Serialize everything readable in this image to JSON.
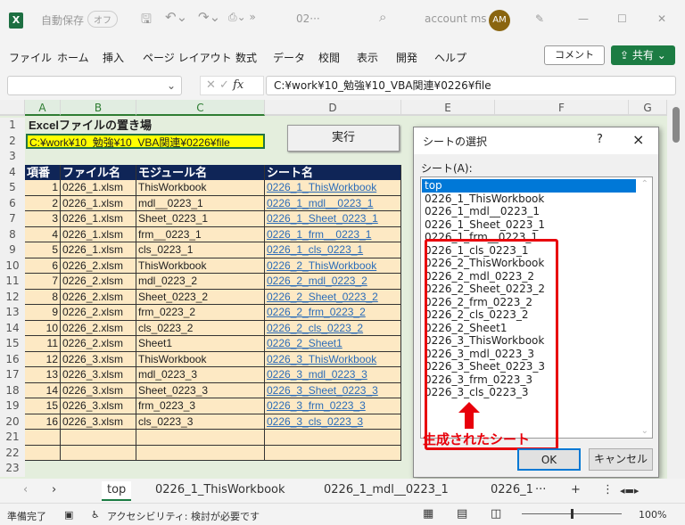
{
  "titlebar": {
    "app_icon": "excel-icon",
    "autosave_label": "自動保存",
    "autosave_state": "オフ",
    "filename": "02···",
    "account": "account ms",
    "avatar_initials": "AM"
  },
  "menu": {
    "items": [
      "ファイル",
      "ホーム",
      "挿入",
      "ページ レイアウト",
      "数式",
      "データ",
      "校閲",
      "表示",
      "開発",
      "ヘルプ"
    ],
    "comment": "コメント",
    "share": "共有"
  },
  "formula_bar": {
    "name_box": "",
    "fx": "fx",
    "value": "C:¥work¥10_勉強¥10_VBA関連¥0226¥file"
  },
  "grid": {
    "columns": [
      "A",
      "B",
      "C",
      "D",
      "E",
      "F",
      "G"
    ],
    "rows": [
      "1",
      "2",
      "3",
      "4",
      "5",
      "6",
      "7",
      "8",
      "9",
      "10",
      "11",
      "12",
      "13",
      "14",
      "15",
      "16",
      "17",
      "18",
      "19",
      "20",
      "21",
      "22",
      "23"
    ],
    "title": "Excelファイルの置き場",
    "path": "C:¥work¥10_勉強¥10_VBA関連¥0226¥file",
    "run_button": "実行",
    "headers": [
      "項番",
      "ファイル名",
      "モジュール名",
      "シート名"
    ],
    "data": [
      [
        "1",
        "0226_1.xlsm",
        "ThisWorkbook",
        "0226_1_ThisWorkbook"
      ],
      [
        "2",
        "0226_1.xlsm",
        "mdl__0223_1",
        "0226_1_mdl__0223_1"
      ],
      [
        "3",
        "0226_1.xlsm",
        "Sheet_0223_1",
        "0226_1_Sheet_0223_1"
      ],
      [
        "4",
        "0226_1.xlsm",
        "frm__0223_1",
        "0226_1_frm__0223_1"
      ],
      [
        "5",
        "0226_1.xlsm",
        "cls_0223_1",
        "0226_1_cls_0223_1"
      ],
      [
        "6",
        "0226_2.xlsm",
        "ThisWorkbook",
        "0226_2_ThisWorkbook"
      ],
      [
        "7",
        "0226_2.xlsm",
        "mdl_0223_2",
        "0226_2_mdl_0223_2"
      ],
      [
        "8",
        "0226_2.xlsm",
        "Sheet_0223_2",
        "0226_2_Sheet_0223_2"
      ],
      [
        "9",
        "0226_2.xlsm",
        "frm_0223_2",
        "0226_2_frm_0223_2"
      ],
      [
        "10",
        "0226_2.xlsm",
        "cls_0223_2",
        "0226_2_cls_0223_2"
      ],
      [
        "11",
        "0226_2.xlsm",
        "Sheet1",
        "0226_2_Sheet1"
      ],
      [
        "12",
        "0226_3.xlsm",
        "ThisWorkbook",
        "0226_3_ThisWorkbook"
      ],
      [
        "13",
        "0226_3.xlsm",
        "mdl_0223_3",
        "0226_3_mdl_0223_3"
      ],
      [
        "14",
        "0226_3.xlsm",
        "Sheet_0223_3",
        "0226_3_Sheet_0223_3"
      ],
      [
        "15",
        "0226_3.xlsm",
        "frm_0223_3",
        "0226_3_frm_0223_3"
      ],
      [
        "16",
        "0226_3.xlsm",
        "cls_0223_3",
        "0226_3_cls_0223_3"
      ],
      [
        "",
        "",
        "",
        ""
      ],
      [
        "",
        "",
        "",
        ""
      ]
    ]
  },
  "dialog": {
    "title": "シートの選択",
    "help": "?",
    "close": "×",
    "list_label": "シート(A):",
    "items": [
      "top",
      "0226_1_ThisWorkbook",
      "0226_1_mdl__0223_1",
      "0226_1_Sheet_0223_1",
      "0226_1_frm__0223_1",
      "0226_1_cls_0223_1",
      "0226_2_ThisWorkbook",
      "0226_2_mdl_0223_2",
      "0226_2_Sheet_0223_2",
      "0226_2_frm_0223_2",
      "0226_2_cls_0223_2",
      "0226_2_Sheet1",
      "0226_3_ThisWorkbook",
      "0226_3_mdl_0223_3",
      "0226_3_Sheet_0223_3",
      "0226_3_frm_0223_3",
      "0226_3_cls_0223_3"
    ],
    "selected": "top",
    "annotation": "生成されたシート",
    "ok": "OK",
    "cancel": "キャンセル",
    "annotation_color": "#e8000b"
  },
  "tabs": {
    "items": [
      "top",
      "0226_1_ThisWorkbook",
      "0226_1_mdl__0223_1",
      "0226_1"
    ],
    "active": "top",
    "more": "···",
    "add": "+"
  },
  "status": {
    "ready": "準備完了",
    "accessibility": "アクセシビリティ: 検討が必要です",
    "zoom": "100%"
  }
}
